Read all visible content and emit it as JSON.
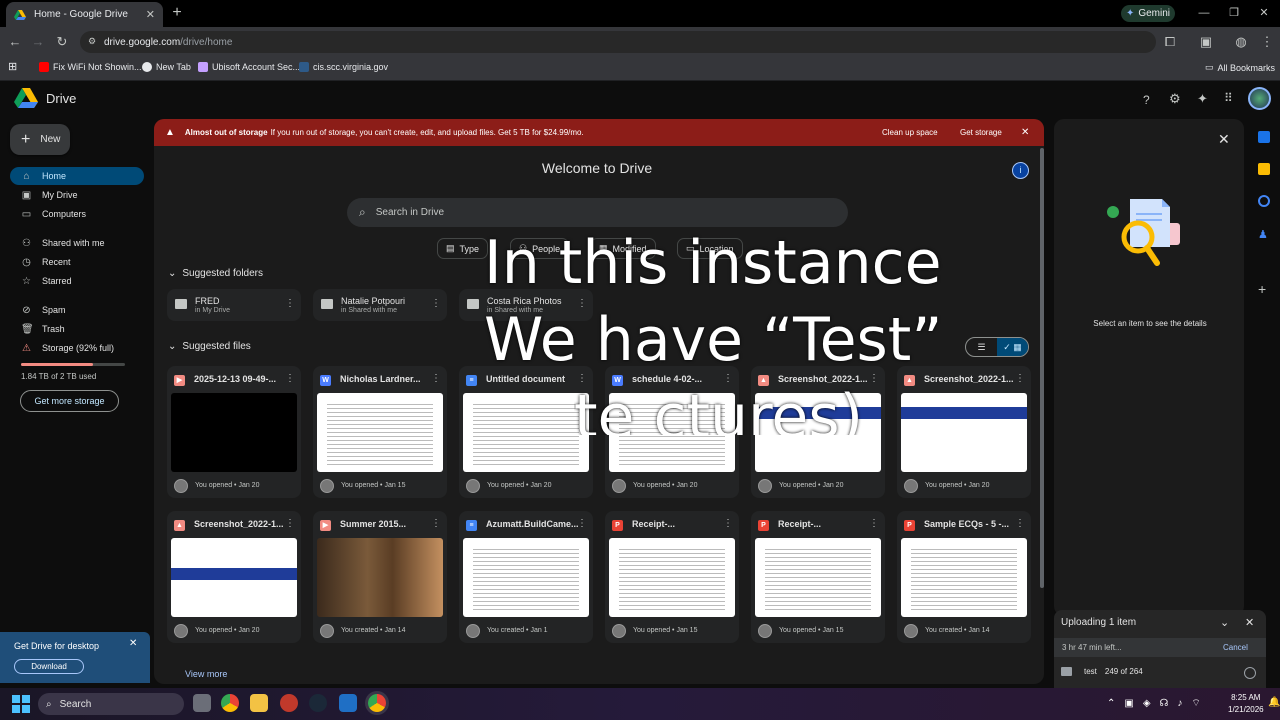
{
  "browser": {
    "tab_title": "Home - Google Drive",
    "gemini_label": "Gemini",
    "url_host": "drive.google.com",
    "url_path": "/drive/home",
    "bookmarks": [
      "Fix WiFi Not Showin...",
      "New Tab",
      "Ubisoft Account Sec...",
      "cis.scc.virginia.gov"
    ],
    "all_bookmarks": "All Bookmarks"
  },
  "app": {
    "name": "Drive",
    "new_label": "New"
  },
  "sidebar": {
    "items": [
      {
        "label": "Home",
        "icon": "home-icon"
      },
      {
        "label": "My Drive",
        "icon": "drive-icon"
      },
      {
        "label": "Computers",
        "icon": "computer-icon"
      },
      {
        "label": "Shared with me",
        "icon": "people-icon"
      },
      {
        "label": "Recent",
        "icon": "clock-icon"
      },
      {
        "label": "Starred",
        "icon": "star-icon"
      },
      {
        "label": "Spam",
        "icon": "spam-icon"
      },
      {
        "label": "Trash",
        "icon": "trash-icon"
      },
      {
        "label": "Storage (92% full)",
        "icon": "warning-icon"
      }
    ],
    "storage_used": "1.84 TB of 2 TB used",
    "storage_fraction": 0.92,
    "get_more": "Get more storage"
  },
  "promo": {
    "title": "Get Drive for desktop",
    "download": "Download"
  },
  "banner": {
    "bold": "Almost out of storage",
    "text": "If you run out of storage, you can't create, edit, and upload files. Get 5 TB for $24.99/mo.",
    "cleanup": "Clean up space",
    "get_storage": "Get storage"
  },
  "main": {
    "welcome": "Welcome to Drive",
    "search_placeholder": "Search in Drive",
    "chips": [
      "Type",
      "People",
      "Modified",
      "Location"
    ],
    "suggested_folders": "Suggested folders",
    "suggested_files": "Suggested files",
    "view_more": "View more",
    "folders": [
      {
        "name": "FRED",
        "location": "in My Drive"
      },
      {
        "name": "Natalie Potpouri",
        "location": "in Shared with me"
      },
      {
        "name": "Costa Rica Photos",
        "location": "in Shared with me"
      }
    ],
    "files": [
      {
        "name": "2025-12-13 09-49-...",
        "type": "video",
        "footer": "You opened • Jan 20"
      },
      {
        "name": "Nicholas Lardner...",
        "type": "word",
        "footer": "You opened • Jan 15"
      },
      {
        "name": "Untitled document",
        "type": "doc",
        "footer": "You opened • Jan 20"
      },
      {
        "name": "schedule 4-02-...",
        "type": "word",
        "footer": "You opened • Jan 20"
      },
      {
        "name": "Screenshot_2022-1...",
        "type": "image",
        "footer": "You opened • Jan 20"
      },
      {
        "name": "Screenshot_2022-1...",
        "type": "image",
        "footer": "You opened • Jan 20"
      },
      {
        "name": "Screenshot_2022-1...",
        "type": "image",
        "footer": "You opened • Jan 20"
      },
      {
        "name": "Summer 2015...",
        "type": "video",
        "footer": "You created • Jan 14"
      },
      {
        "name": "Azumatt.BuildCame...",
        "type": "doc",
        "footer": "You created • Jan 1"
      },
      {
        "name": "Receipt-...",
        "type": "pdf",
        "footer": "You opened • Jan 15"
      },
      {
        "name": "Receipt-...",
        "type": "pdf",
        "footer": "You opened • Jan 15"
      },
      {
        "name": "Sample ECQs - 5 -...",
        "type": "pdf",
        "footer": "You created • Jan 14"
      }
    ]
  },
  "details": {
    "empty_text": "Select an item to see the details"
  },
  "upload": {
    "title": "Uploading 1 item",
    "time_left": "3 hr 47 min left...",
    "cancel": "Cancel",
    "file_name": "test",
    "progress": "249 of 264"
  },
  "overlay": {
    "line1": "In this instance",
    "line2": "We have “Test”",
    "line3": "te ctures)"
  },
  "taskbar": {
    "search": "Search",
    "time": "8:25 AM",
    "date": "1/21/2026"
  },
  "colors": {
    "banner": "#8c1d18",
    "active_nav": "#004a77",
    "accent": "#a8c7fa"
  }
}
